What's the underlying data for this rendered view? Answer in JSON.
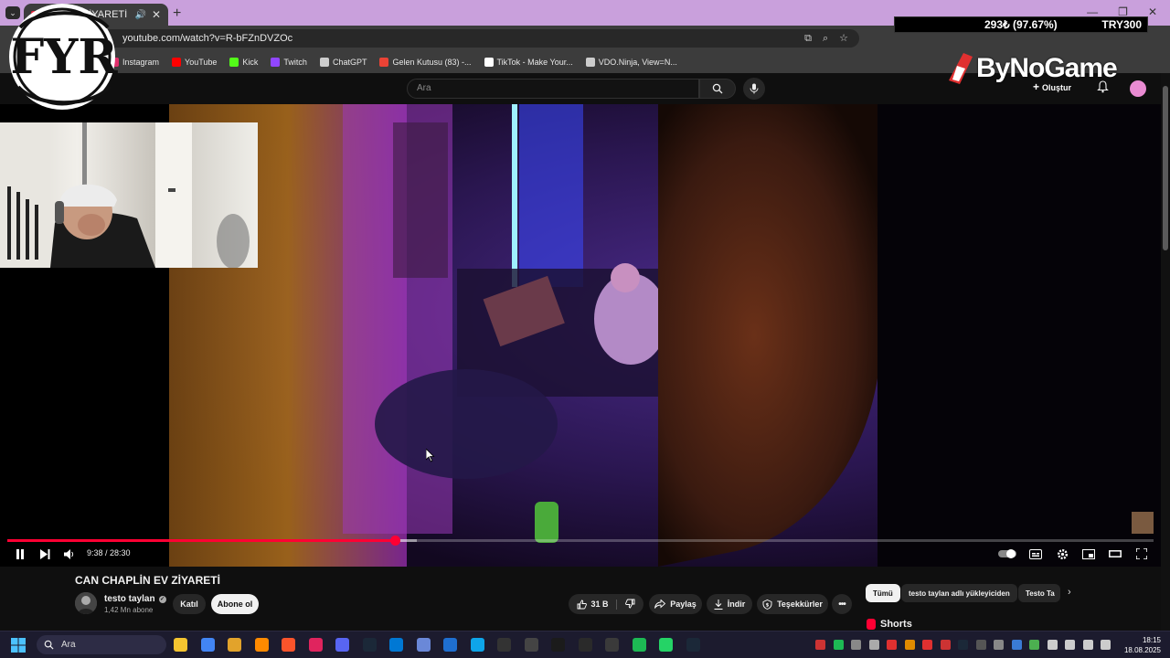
{
  "browser": {
    "tab_title": "CAN ... ZİYARETİ",
    "url": "youtube.com/watch?v=R-bFZnDVZOc",
    "bookmarks": [
      {
        "label": "Instagram",
        "color": "#e1306c"
      },
      {
        "label": "YouTube",
        "color": "#ff0000"
      },
      {
        "label": "Kick",
        "color": "#53fc18"
      },
      {
        "label": "Twitch",
        "color": "#9146ff"
      },
      {
        "label": "ChatGPT",
        "color": "#cccccc"
      },
      {
        "label": "Gelen Kutusu (83) -...",
        "color": "#ea4335"
      },
      {
        "label": "TikTok - Make Your...",
        "color": "#ffffff"
      },
      {
        "label": "VDO.Ninja, View=N...",
        "color": "#cccccc"
      }
    ]
  },
  "overlay": {
    "price": "293₺ (97.67%)",
    "currency": "TRY300",
    "logo_text": "FYR",
    "sponsor": "ByNoGame"
  },
  "youtube": {
    "search_placeholder": "Ara",
    "create_label": "Oluştur",
    "video": {
      "current_time": "9:38",
      "duration": "28:30",
      "time_display": "9:38 / 28:30",
      "progress": 0.3378,
      "buffered": 0.357,
      "title": "CAN CHAPLİN EV ZİYARETİ",
      "channel": "testo taylan",
      "subscribers": "1,42 Mn abone",
      "join_label": "Katıl",
      "subscribe_label": "Abone ol",
      "likes": "31 B",
      "share_label": "Paylaş",
      "download_label": "İndir",
      "thanks_label": "Teşekkürler"
    },
    "chips": [
      "Tümü",
      "testo taylan adlı yükleyiciden",
      "Testo Ta"
    ],
    "shorts_label": "Shorts"
  },
  "taskbar": {
    "search_placeholder": "Ara",
    "time": "18:15",
    "date": "18.08.2025"
  },
  "colors": {
    "accent": "#ff0033",
    "tab_strip": "#c9a0dc"
  }
}
